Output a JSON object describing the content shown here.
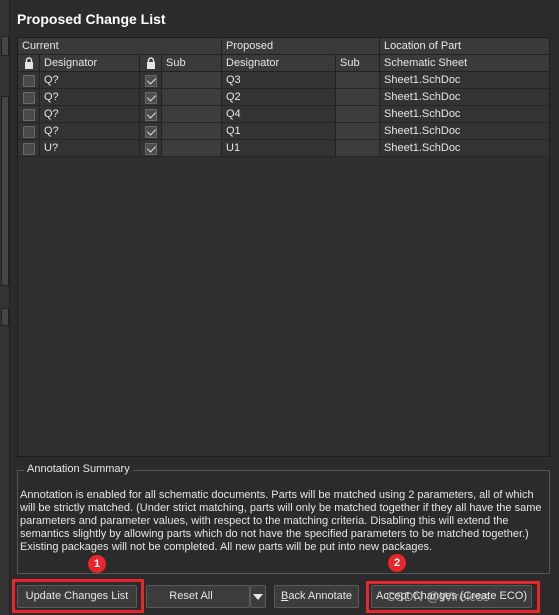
{
  "title": "Proposed Change List",
  "groups": {
    "current": "Current",
    "proposed": "Proposed",
    "location": "Location of Part"
  },
  "headers": {
    "designator": "Designator",
    "sub": "Sub",
    "proposed_designator": "Designator",
    "proposed_sub": "Sub",
    "schematic_sheet": "Schematic Sheet"
  },
  "rows": [
    {
      "current": "Q?",
      "proposed": "Q3",
      "sheet": "Sheet1.SchDoc"
    },
    {
      "current": "Q?",
      "proposed": "Q2",
      "sheet": "Sheet1.SchDoc"
    },
    {
      "current": "Q?",
      "proposed": "Q4",
      "sheet": "Sheet1.SchDoc"
    },
    {
      "current": "Q?",
      "proposed": "Q1",
      "sheet": "Sheet1.SchDoc"
    },
    {
      "current": "U?",
      "proposed": "U1",
      "sheet": "Sheet1.SchDoc"
    }
  ],
  "summary": {
    "legend": "Annotation Summary",
    "text": "Annotation is enabled for all schematic documents. Parts will be matched using 2 parameters, all of which will be strictly matched. (Under strict matching, parts will only be matched together if they all have the same parameters and parameter values, with respect to the matching criteria. Disabling this will extend the semantics slightly by allowing parts which do not have the specified parameters to be matched together.) Existing packages will not be completed. All new parts will be put into new packages."
  },
  "buttons": {
    "update": "Update Changes List",
    "reset": "Reset All",
    "back_annotate_first": "B",
    "back_annotate_rest": "ack Annotate",
    "accept": "Accept Changes (Create ECO)"
  },
  "markers": {
    "one": "1",
    "two": "2"
  },
  "watermark": "CSDN @Wireless"
}
